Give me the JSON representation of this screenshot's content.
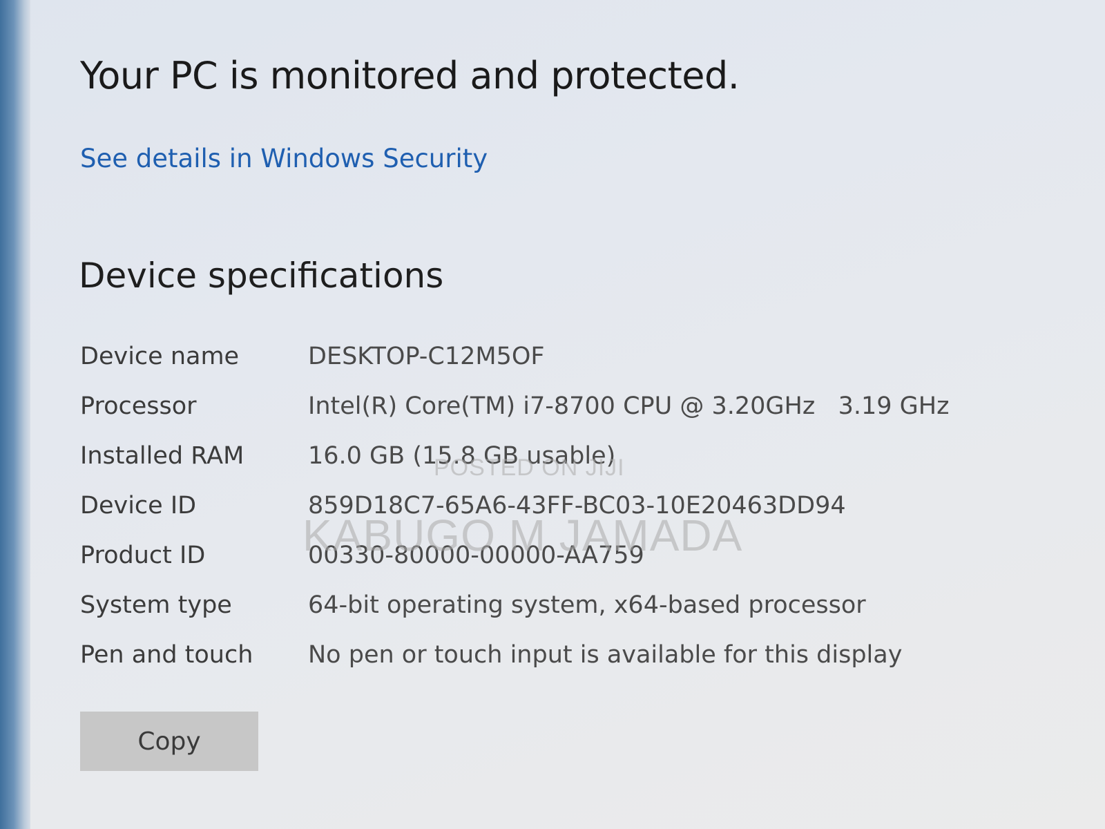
{
  "security": {
    "heading": "Your PC is monitored and protected.",
    "link_label": "See details in Windows Security",
    "link_color": "#1f5fb0"
  },
  "specs": {
    "title": "Device specifications",
    "rows": [
      {
        "label": "Device name",
        "value": "DESKTOP-C12M5OF"
      },
      {
        "label": "Processor",
        "value": "Intel(R) Core(TM) i7-8700 CPU @ 3.20GHz   3.19 GHz"
      },
      {
        "label": "Installed RAM",
        "value": "16.0 GB (15.8 GB usable)"
      },
      {
        "label": "Device ID",
        "value": "859D18C7-65A6-43FF-BC03-10E20463DD94"
      },
      {
        "label": "Product ID",
        "value": "00330-80000-00000-AA759"
      },
      {
        "label": "System type",
        "value": "64-bit operating system, x64-based processor"
      },
      {
        "label": "Pen and touch",
        "value": "No pen or touch input is available for this display"
      }
    ],
    "copy_label": "Copy"
  },
  "watermark": {
    "line1": "POSTED ON JIJI",
    "line2": "KABUGO M JAMADA"
  }
}
